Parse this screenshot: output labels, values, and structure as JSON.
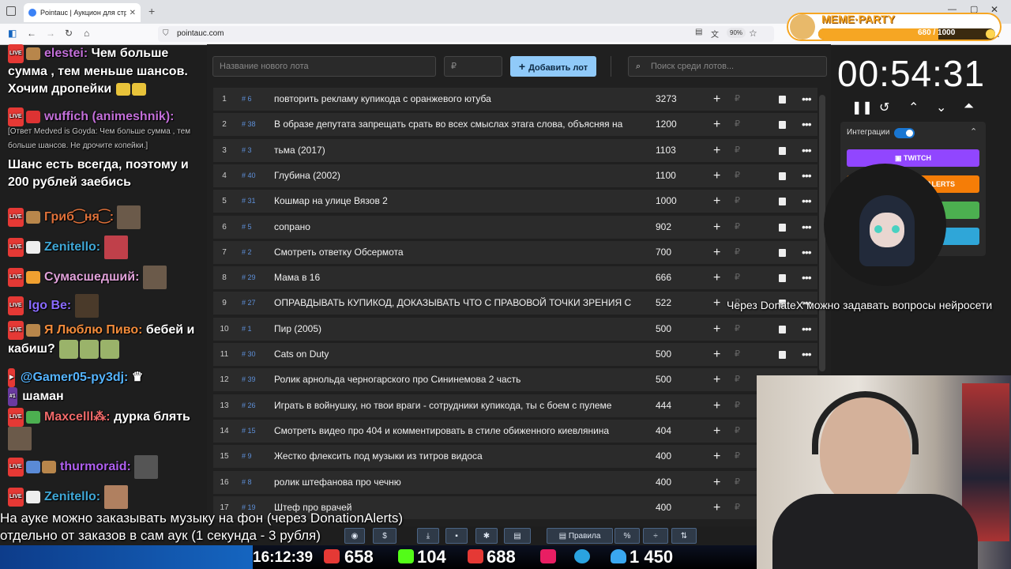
{
  "browser": {
    "tab_title": "Pointauc | Аукцион для стримеров",
    "url": "pointauc.com",
    "zoom": "90%"
  },
  "meme_party": {
    "title": "MEME·PARTY",
    "progress": "680 / 1000",
    "fill": 0.68
  },
  "chat": [
    {
      "user": "elestei:",
      "text": "Чем больше сумма , тем меньше шансов. Хочим дропейки",
      "color": "#c36fd9"
    },
    {
      "user": "wuffich (animeshnik):",
      "text": "",
      "color": "#c36fd9"
    },
    {
      "user": "",
      "text": "[Ответ Medved is Goyda: Чем больше сумма , тем больше шансов. Не дрочите копейки.]",
      "color": "#cccccc"
    },
    {
      "user": "",
      "text": "Шанс есть всегда, поэтому и 200 рублей заебись",
      "color": "#ffffff"
    },
    {
      "user": "Гриб⁐ня⁐:",
      "text": "",
      "color": "#e0713a"
    },
    {
      "user": "Zenitello:",
      "text": "",
      "color": "#3fa7d6"
    },
    {
      "user": "Сумасшедший:",
      "text": "",
      "color": "#e0a1d9"
    },
    {
      "user": "Igo Be:",
      "text": "",
      "color": "#8a6bff"
    },
    {
      "user": "Я Люблю Пиво:",
      "text": "бебей и кабиш?",
      "color": "#f28b3b"
    },
    {
      "user": "@Gamer05-py3dj:",
      "text": "шаман",
      "color": "#55b4ff"
    },
    {
      "user": "Maxcelll⁂:",
      "text": "дурка блять",
      "color": "#f26a6a"
    },
    {
      "user": "thurmoraid:",
      "text": "",
      "color": "#b060f0"
    },
    {
      "user": "Zenitello:",
      "text": "",
      "color": "#3fa7d6"
    }
  ],
  "auction": {
    "lot_name_placeholder": "Название нового лота",
    "amount_placeholder": "₽",
    "add_button": "Добавить лот",
    "search_placeholder": "Поиск среди лотов...",
    "currency": "₽",
    "lots": [
      {
        "n": "1",
        "id": "# 6",
        "name": "повторить рекламу купикода с оранжевого ютуба",
        "amount": "3273"
      },
      {
        "n": "2",
        "id": "# 38",
        "name": "В образе депутата запрещать срать во всех смыслах этага слова, объясняя на",
        "amount": "1200"
      },
      {
        "n": "3",
        "id": "# 3",
        "name": "тьма (2017)",
        "amount": "1103"
      },
      {
        "n": "4",
        "id": "# 40",
        "name": "Глубина (2002)",
        "amount": "1100"
      },
      {
        "n": "5",
        "id": "# 31",
        "name": "Кошмар на улице Вязов 2",
        "amount": "1000"
      },
      {
        "n": "6",
        "id": "# 5",
        "name": "сопрано",
        "amount": "902"
      },
      {
        "n": "7",
        "id": "# 2",
        "name": "Смотреть ответку Обсермота",
        "amount": "700"
      },
      {
        "n": "8",
        "id": "# 29",
        "name": "Мама в 16",
        "amount": "666"
      },
      {
        "n": "9",
        "id": "# 27",
        "name": "ОПРАВДЫВАТЬ КУПИКОД, ДОКАЗЫВАТЬ ЧТО С ПРАВОВОЙ ТОЧКИ ЗРЕНИЯ С",
        "amount": "522"
      },
      {
        "n": "10",
        "id": "# 1",
        "name": "Пир (2005)",
        "amount": "500"
      },
      {
        "n": "11",
        "id": "# 30",
        "name": "Cats on Duty",
        "amount": "500"
      },
      {
        "n": "12",
        "id": "# 39",
        "name": "Ролик арнольда черногарского про Сининемова 2 часть",
        "amount": "500"
      },
      {
        "n": "13",
        "id": "# 26",
        "name": "Играть в войнушку, но твои враги - сотрудники купикода, ты с боем с пулеме",
        "amount": "444"
      },
      {
        "n": "14",
        "id": "# 15",
        "name": "Смотреть видео про 404 и комментировать в стиле обиженного киевлянина",
        "amount": "404"
      },
      {
        "n": "15",
        "id": "# 9",
        "name": "Жестко флексить под музыки из титров видоса",
        "amount": "400"
      },
      {
        "n": "16",
        "id": "# 8",
        "name": " ролик штефанова про чечню",
        "amount": "400"
      },
      {
        "n": "17",
        "id": "# 19",
        "name": "Штеф про врачей",
        "amount": "400"
      }
    ]
  },
  "timer": "00:54:31",
  "integrations": {
    "label": "Интеграции",
    "twitch": "TWITCH",
    "alerts": "ALERTS",
    "colors": {
      "twitch": "#9146ff",
      "alerts": "#f57d07",
      "green": "#4caf50",
      "blue": "#2fa6d8"
    }
  },
  "overlay": {
    "donatex": "Через DonateX можно задавать вопросы нейросети",
    "music_line1": "На ауке можно заказывать музыку на фон (через DonationAlerts)",
    "music_line2": "отдельно от заказов в сам аук (1 секунда - 3 рубля)"
  },
  "toolbar": {
    "rules": "Правила",
    "percent": "%",
    "dollar": "$"
  },
  "status": {
    "time": "16:12:39",
    "youtube": "658",
    "kick": "104",
    "vk": "688",
    "total": "1 450"
  }
}
